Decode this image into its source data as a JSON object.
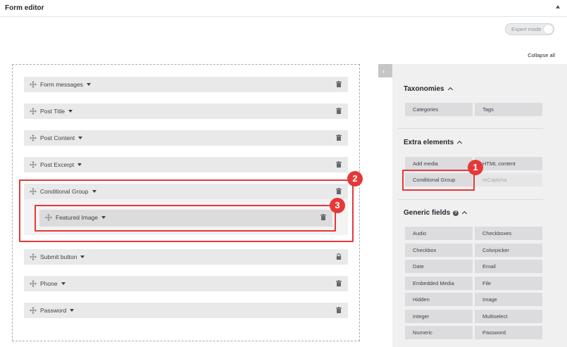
{
  "header": {
    "title": "Form editor"
  },
  "toolbar": {
    "expert_mode": "Expert mode",
    "collapse_all": "Collapse all"
  },
  "fields": [
    {
      "label": "Form messages",
      "action": "trash"
    },
    {
      "label": "Post Title",
      "action": "trash"
    },
    {
      "label": "Post Content",
      "action": "trash"
    },
    {
      "label": "Post Excerpt",
      "action": "trash"
    },
    {
      "label": "Conditional Group",
      "action": "trash"
    },
    {
      "label": "Featured Image",
      "action": "trash"
    },
    {
      "label": "Submit button",
      "action": "lock"
    },
    {
      "label": "Phone",
      "action": "trash"
    },
    {
      "label": "Password",
      "action": "trash"
    }
  ],
  "sidebar": {
    "taxonomies": {
      "title": "Taxonomies",
      "items": [
        "Categories",
        "Tags"
      ]
    },
    "extra_elements": {
      "title": "Extra elements",
      "items": [
        "Add media",
        "HTML content",
        "Conditional Group",
        "reCaptcha"
      ]
    },
    "generic_fields": {
      "title": "Generic fields",
      "items": [
        "Audio",
        "Checkboxes",
        "Checkbox",
        "Colorpicker",
        "Date",
        "Email",
        "Embedded Media",
        "File",
        "Hidden",
        "Image",
        "Integer",
        "Multiselect",
        "Numeric",
        "Password"
      ]
    }
  },
  "annotations": [
    "1",
    "2",
    "3"
  ],
  "colors": {
    "highlight": "#e53838",
    "field_bg": "#e9e9e9",
    "sidebar_bg": "#f0f0f1"
  }
}
